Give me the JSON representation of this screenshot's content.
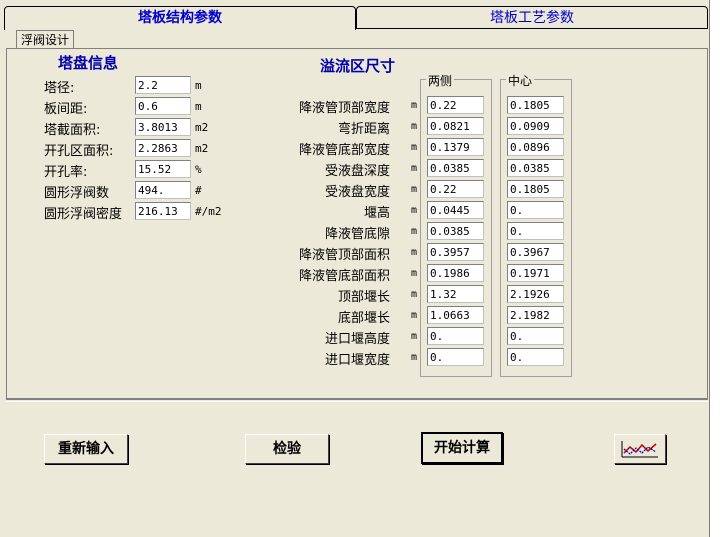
{
  "tabs": {
    "active": "塔板结构参数",
    "inactive": "塔板工艺参数"
  },
  "subtab": "浮阀设计",
  "tray_info": {
    "title": "塔盘信息",
    "rows": [
      {
        "label": "塔径:",
        "value": "2.2",
        "unit": "m"
      },
      {
        "label": "板间距:",
        "value": "0.6",
        "unit": "m"
      },
      {
        "label": "塔截面积:",
        "value": "3.8013",
        "unit": "m2"
      },
      {
        "label": "开孔区面积:",
        "value": "2.2863",
        "unit": "m2"
      },
      {
        "label": "开孔率:",
        "value": "15.52",
        "unit": "%"
      },
      {
        "label": "圆形浮阀数",
        "value": "494.",
        "unit": "#"
      },
      {
        "label": "圆形浮阀密度",
        "value": "216.13",
        "unit": "#/m2"
      }
    ]
  },
  "overflow": {
    "title": "溢流区尺寸",
    "col_side": "两侧",
    "col_center": "中心",
    "rows": [
      {
        "label": "降液管顶部宽度",
        "unit": "m",
        "side": "0.22",
        "center": "0.1805"
      },
      {
        "label": "弯折距离",
        "unit": "m",
        "side": "0.0821",
        "center": "0.0909"
      },
      {
        "label": "降液管底部宽度",
        "unit": "m",
        "side": "0.1379",
        "center": "0.0896"
      },
      {
        "label": "受液盘深度",
        "unit": "m",
        "side": "0.0385",
        "center": "0.0385"
      },
      {
        "label": "受液盘宽度",
        "unit": "m",
        "side": "0.22",
        "center": "0.1805"
      },
      {
        "label": "堰高",
        "unit": "m",
        "side": "0.0445",
        "center": "0."
      },
      {
        "label": "降液管底隙",
        "unit": "m",
        "side": "0.0385",
        "center": "0."
      },
      {
        "label": "降液管顶部面积",
        "unit": "m",
        "side": "0.3957",
        "center": "0.3967"
      },
      {
        "label": "降液管底部面积",
        "unit": "m",
        "side": "0.1986",
        "center": "0.1971"
      },
      {
        "label": "顶部堰长",
        "unit": "m",
        "side": "1.32",
        "center": "2.1926"
      },
      {
        "label": "底部堰长",
        "unit": "m",
        "side": "1.0663",
        "center": "2.1982"
      },
      {
        "label": "进口堰高度",
        "unit": "m",
        "side": "0.",
        "center": "0."
      },
      {
        "label": "进口堰宽度",
        "unit": "m",
        "side": "0.",
        "center": "0."
      }
    ]
  },
  "buttons": {
    "reset": "重新输入",
    "check": "检验",
    "start": "开始计算",
    "chart_icon": "line-chart-icon"
  }
}
